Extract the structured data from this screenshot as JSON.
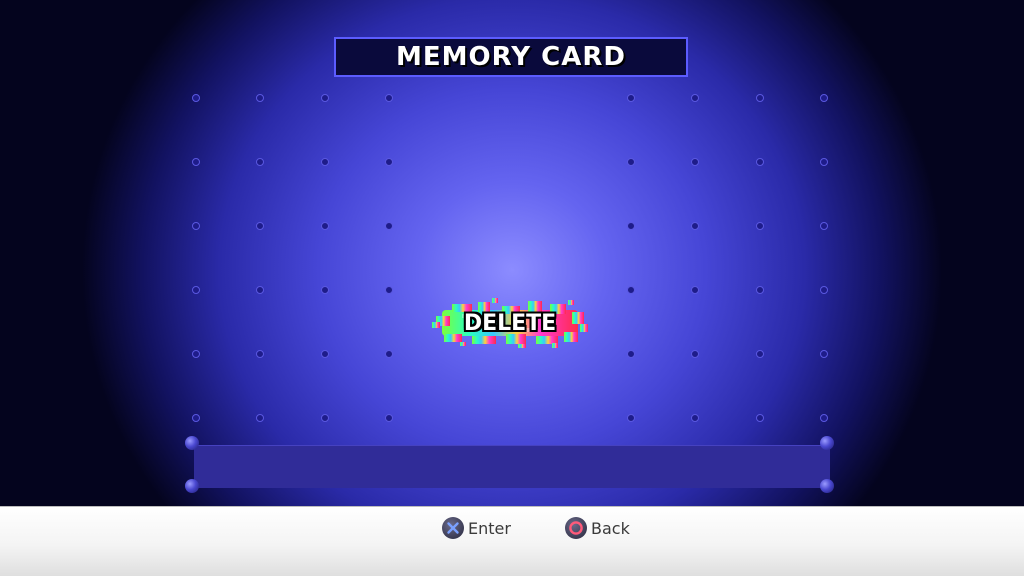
{
  "screen": {
    "title": "MEMORY CARD"
  },
  "menu": {
    "selected": "DELETE",
    "items": [
      {
        "label": "DELETE"
      }
    ]
  },
  "footer": {
    "hints": [
      {
        "icon": "cross-button-icon",
        "label": "Enter"
      },
      {
        "icon": "circle-button-icon",
        "label": "Back"
      }
    ]
  },
  "colors": {
    "background_center": "#8c8cff",
    "background_edge": "#04041e",
    "title_border": "#5c5cff",
    "panel": "#302c98",
    "cross_symbol": "#7aa0ff",
    "circle_symbol": "#ff5a7a"
  }
}
